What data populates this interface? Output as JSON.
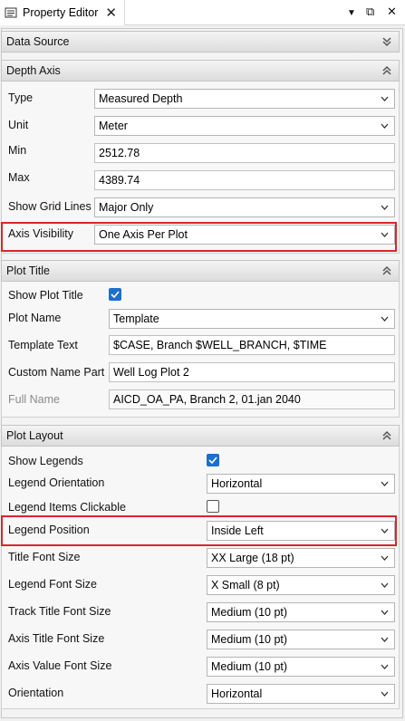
{
  "window": {
    "tab_title": "Property Editor",
    "close_glyph": "✕",
    "menu_glyph": "▼",
    "float_glyph": "⧉",
    "window_close_glyph": "✕"
  },
  "colors": {
    "highlight": "#d9262b",
    "checkbox_checked": "#1d6fcc"
  },
  "groups": {
    "data_source": {
      "title": "Data Source",
      "collapsed": true
    },
    "depth_axis": {
      "title": "Depth Axis",
      "type_label": "Type",
      "type_value": "Measured Depth",
      "unit_label": "Unit",
      "unit_value": "Meter",
      "min_label": "Min",
      "min_value": "2512.78",
      "max_label": "Max",
      "max_value": "4389.74",
      "grid_label": "Show Grid Lines",
      "grid_value": "Major Only",
      "visibility_label": "Axis Visibility",
      "visibility_value": "One Axis Per Plot"
    },
    "plot_title": {
      "title": "Plot Title",
      "show_label": "Show Plot Title",
      "show_checked": true,
      "name_label": "Plot Name",
      "name_value": "Template",
      "template_label": "Template Text",
      "template_value": "$CASE,  Branch $WELL_BRANCH, $TIME",
      "custom_label": "Custom Name Part",
      "custom_value": "Well Log Plot 2",
      "full_label": "Full Name",
      "full_value": "AICD_OA_PA,  Branch 2, 01.jan 2040"
    },
    "plot_layout": {
      "title": "Plot Layout",
      "legends_label": "Show Legends",
      "legends_checked": true,
      "orientation_label": "Legend Orientation",
      "orientation_value": "Horizontal",
      "clickable_label": "Legend Items Clickable",
      "clickable_checked": false,
      "position_label": "Legend Position",
      "position_value": "Inside Left",
      "title_font_label": "Title Font Size",
      "title_font_value": "XX Large (18 pt)",
      "legend_font_label": "Legend Font Size",
      "legend_font_value": "X Small (8 pt)",
      "track_font_label": "Track Title Font Size",
      "track_font_value": "Medium (10 pt)",
      "axis_title_font_label": "Axis Title Font Size",
      "axis_title_font_value": "Medium (10 pt)",
      "axis_value_font_label": "Axis Value Font Size",
      "axis_value_font_value": "Medium (10 pt)",
      "plot_orientation_label": "Orientation",
      "plot_orientation_value": "Horizontal"
    }
  }
}
